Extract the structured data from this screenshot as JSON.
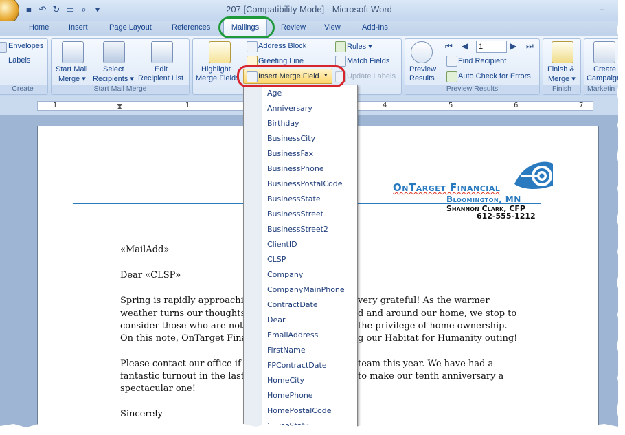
{
  "window": {
    "title": "207 [Compatibility Mode] - Microsoft Word",
    "minimize_glyph": "–"
  },
  "qat": {
    "icons": [
      "save-icon",
      "undo-icon",
      "redo-icon",
      "open-icon",
      "print-preview-icon"
    ]
  },
  "tabs": [
    "Home",
    "Insert",
    "Page Layout",
    "References",
    "Mailings",
    "Review",
    "View",
    "Add-Ins"
  ],
  "ribbon": {
    "create": {
      "label": "Create",
      "envelopes": "Envelopes",
      "labels": "Labels"
    },
    "start": {
      "label": "Start Mail Merge",
      "start_line1": "Start Mail",
      "start_line2": "Merge ▾",
      "select_line1": "Select",
      "select_line2": "Recipients ▾",
      "edit_line1": "Edit",
      "edit_line2": "Recipient List"
    },
    "write": {
      "highlight_line1": "Highlight",
      "highlight_line2": "Merge Fields",
      "address_block": "Address Block",
      "greeting_line": "Greeting Line",
      "insert_merge_field": "Insert Merge Field",
      "rules": "Rules ▾",
      "match_fields": "Match Fields",
      "update_labels": "Update Labels"
    },
    "preview": {
      "label": "Preview Results",
      "preview_line1": "Preview",
      "preview_line2": "Results",
      "record": "1",
      "find_recipient": "Find Recipient",
      "auto_check": "Auto Check for Errors"
    },
    "finish": {
      "label": "Finish",
      "line1": "Finish &",
      "line2": "Merge ▾"
    },
    "campaign": {
      "label": "Marketin",
      "line1": "Create",
      "line2": "Campaign"
    }
  },
  "ruler": {
    "numbers": [
      "1",
      "1",
      "2",
      "3",
      "4",
      "5",
      "6",
      "7"
    ]
  },
  "document": {
    "header": {
      "company": "OnTarget Financial",
      "city": "Bloomington, MN",
      "person": "Shannon Clark, CFP",
      "phone": "612-555-1212"
    },
    "mail_add": "«MailAdd»",
    "greeting": "Dear «CLSP»",
    "p1": [
      "Spring is rapidly approachin",
      "weather turns our thoughts t",
      "consider those who are not f",
      "On this note, OnTarget  Fina"
    ],
    "p1_right": [
      "very grateful!  As the warmer",
      "d and around our home, we stop to",
      "the privilege  of home ownership.",
      "g our Habitat for Humanity outing!"
    ],
    "p2": [
      "Please contact our office if y",
      "fantastic turnout in the last r",
      "spectacular one!"
    ],
    "p2_right": [
      "team this  year.  We have had a",
      "to make our tenth anniversary  a",
      ""
    ],
    "closing": "Sincerely"
  },
  "merge_fields": [
    "Age",
    "Anniversary",
    "Birthday",
    "BusinessCity",
    "BusinessFax",
    "BusinessPhone",
    "BusinessPostalCode",
    "BusinessState",
    "BusinessStreet",
    "BusinessStreet2",
    "ClientID",
    "CLSP",
    "Company",
    "CompanyMainPhone",
    "ContractDate",
    "Dear",
    "EmailAddress",
    "FirstName",
    "FPContractDate",
    "HomeCity",
    "HomePhone",
    "HomePostalCode",
    "HomeState"
  ],
  "colors": {
    "highlight_green": "#1f9a3a",
    "highlight_red": "#d8242b",
    "brand_blue": "#2a7ac0"
  }
}
